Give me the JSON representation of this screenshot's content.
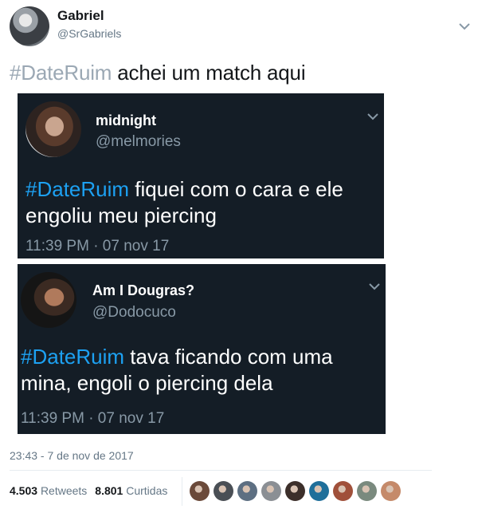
{
  "tweet": {
    "author_name": "Gabriel",
    "author_handle": "@SrGabriels",
    "hashtag": "#DateRuim",
    "text": " achei um match aqui",
    "timestamp": "23:43 - 7 de nov de 2017",
    "retweets_count": "4.503",
    "retweets_label": "Retweets",
    "likes_count": "8.801",
    "likes_label": "Curtidas"
  },
  "embedded": [
    {
      "name": "midnight",
      "handle": "@melmories",
      "hashtag": "#DateRuim",
      "text_line1": " fiquei com o cara e ele",
      "text_line2": "engoliu meu piercing",
      "time": "11:39 PM · 07 nov 17"
    },
    {
      "name": "Am I Dougras?",
      "handle": "@Dodocuco",
      "hashtag": "#DateRuim",
      "text_line1": " tava ficando com uma",
      "text_line2": "mina, engoli o piercing dela",
      "time": "11:39 PM · 07 nov 17"
    }
  ],
  "likers": [
    {
      "color": "#6b4a3a"
    },
    {
      "color": "#4a4f55"
    },
    {
      "color": "#5d6f82"
    },
    {
      "color": "#8b8f94"
    },
    {
      "color": "#3c2f2a"
    },
    {
      "color": "#1f6f9a"
    },
    {
      "color": "#a0503a"
    },
    {
      "color": "#7a8a7e"
    },
    {
      "color": "#c58a6a"
    }
  ],
  "colors": {
    "card_bg": "#141d26",
    "hashtag_blue": "#1da1f2",
    "hashtag_grey": "#9ba8b4",
    "muted": "#657786"
  }
}
